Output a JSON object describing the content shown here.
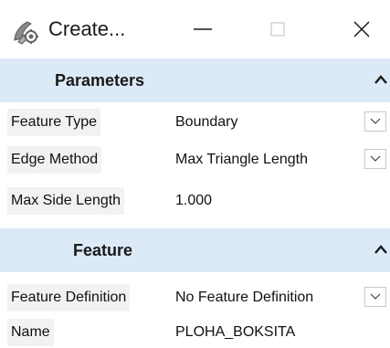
{
  "window": {
    "title": "Create...",
    "icon": "create-feature-icon"
  },
  "sections": {
    "parameters": {
      "title": "Parameters",
      "rows": {
        "feature_type": {
          "label": "Feature Type",
          "value": "Boundary"
        },
        "edge_method": {
          "label": "Edge Method",
          "value": "Max Triangle Length"
        },
        "max_side_length": {
          "label": "Max Side Length",
          "value": "1.000"
        }
      }
    },
    "feature": {
      "title": "Feature",
      "rows": {
        "feature_definition": {
          "label": "Feature Definition",
          "value": "No Feature Definition"
        },
        "name": {
          "label": "Name",
          "value": "PLOHA_BOKSITA"
        }
      }
    }
  },
  "colors": {
    "section_header_bg": "#dce9f7",
    "label_bg": "#f2f2f2",
    "dropdown_border": "#c8c8c8"
  }
}
